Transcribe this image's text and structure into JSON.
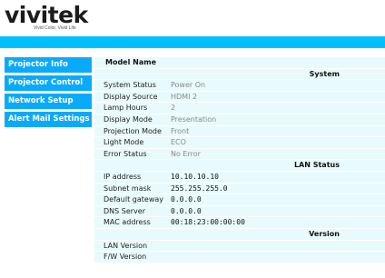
{
  "brand": {
    "name": "vivitek",
    "tagline": "Vivid Color, Vivid Life"
  },
  "colors": {
    "banner": "#00bfff",
    "nav": "#0aaafb",
    "table_row": "#e8fafd"
  },
  "sidebar": {
    "items": [
      {
        "label": "Projector Info"
      },
      {
        "label": "Projector Control"
      },
      {
        "label": "Network Setup"
      },
      {
        "label": "Alert Mail Settings"
      }
    ]
  },
  "table": {
    "model_label": "Model Name",
    "model_value": "",
    "system_header": "System",
    "system_rows": [
      {
        "label": "System Status",
        "value": "Power On"
      },
      {
        "label": "Display Source",
        "value": "HDMI 2"
      },
      {
        "label": "Lamp Hours",
        "value": "2"
      },
      {
        "label": "Display Mode",
        "value": "Presentation"
      },
      {
        "label": "Projection Mode",
        "value": "Front"
      },
      {
        "label": "Light Mode",
        "value": "ECO"
      },
      {
        "label": "Error Status",
        "value": "No Error"
      }
    ],
    "lan_header": "LAN Status",
    "lan_rows": [
      {
        "label": "IP address",
        "value": "10.10.10.10"
      },
      {
        "label": "Subnet mask",
        "value": "255.255.255.0"
      },
      {
        "label": "Default gateway",
        "value": "0.0.0.0"
      },
      {
        "label": "DNS Server",
        "value": "0.0.0.0"
      },
      {
        "label": "MAC address",
        "value": "00:18:23:00:00:00"
      }
    ],
    "version_header": "Version",
    "version_rows": [
      {
        "label": "LAN Version",
        "value": ""
      },
      {
        "label": "F/W Version",
        "value": ""
      }
    ]
  }
}
